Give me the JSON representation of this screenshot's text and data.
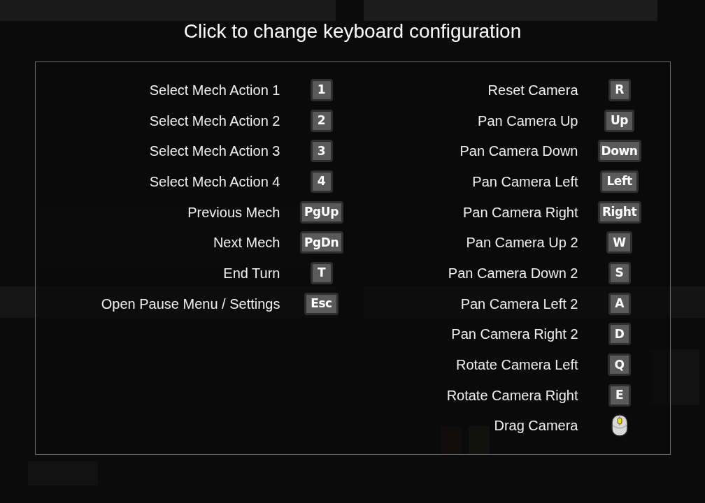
{
  "title": "Click to change keyboard configuration",
  "columns": [
    {
      "bindings": [
        {
          "action": "Select Mech Action 1",
          "kind": "key",
          "key": "1"
        },
        {
          "action": "Select Mech Action 2",
          "kind": "key",
          "key": "2"
        },
        {
          "action": "Select Mech Action 3",
          "kind": "key",
          "key": "3"
        },
        {
          "action": "Select Mech Action 4",
          "kind": "key",
          "key": "4"
        },
        {
          "action": "Previous Mech",
          "kind": "key",
          "key": "PgUp"
        },
        {
          "action": "Next Mech",
          "kind": "key",
          "key": "PgDn"
        },
        {
          "action": "End Turn",
          "kind": "key",
          "key": "T"
        },
        {
          "action": "Open Pause Menu / Settings",
          "kind": "key",
          "key": "Esc"
        }
      ]
    },
    {
      "bindings": [
        {
          "action": "Reset Camera",
          "kind": "key",
          "key": "R"
        },
        {
          "action": "Pan Camera Up",
          "kind": "key",
          "key": "Up"
        },
        {
          "action": "Pan Camera Down",
          "kind": "key",
          "key": "Down"
        },
        {
          "action": "Pan Camera Left",
          "kind": "key",
          "key": "Left"
        },
        {
          "action": "Pan Camera Right",
          "kind": "key",
          "key": "Right"
        },
        {
          "action": "Pan Camera Up 2",
          "kind": "key",
          "key": "W"
        },
        {
          "action": "Pan Camera Down 2",
          "kind": "key",
          "key": "S"
        },
        {
          "action": "Pan Camera Left 2",
          "kind": "key",
          "key": "A"
        },
        {
          "action": "Pan Camera Right 2",
          "kind": "key",
          "key": "D"
        },
        {
          "action": "Rotate Camera Left",
          "kind": "key",
          "key": "Q"
        },
        {
          "action": "Rotate Camera Right",
          "kind": "key",
          "key": "E"
        },
        {
          "action": "Drag Camera",
          "kind": "mouse"
        }
      ]
    }
  ]
}
